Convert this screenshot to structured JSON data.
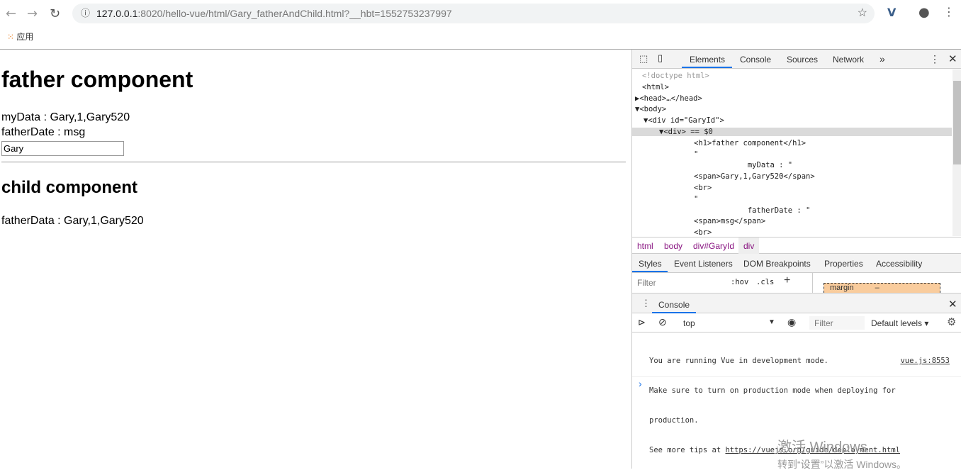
{
  "browser": {
    "url_host": "127.0.0.1",
    "url_rest": ":8020/hello-vue/html/Gary_fatherAndChild.html?__hbt=1552753237997",
    "bookmark": "应用"
  },
  "page": {
    "h1": "father component",
    "mydata_line": "myData : Gary,1,Gary520",
    "fatherdate_line": "fatherDate : msg",
    "input_value": "Gary",
    "h2": "child component",
    "fatherdata_line": "fatherData : Gary,1,Gary520"
  },
  "devtools": {
    "tabs": [
      "Elements",
      "Console",
      "Sources",
      "Network",
      "»"
    ],
    "dom": [
      {
        "t": "<!doctype html>",
        "c": "#999"
      },
      {
        "t": "<html>"
      },
      {
        "t": "▶<head>…</head>"
      },
      {
        "t": "▼<body>"
      },
      {
        "t": "▼<div id=\"GaryId\">"
      },
      {
        "t": "▼<div> == $0"
      },
      {
        "t": "<h1>father component</h1>"
      },
      {
        "t": "\""
      },
      {
        "t": "            myData : \""
      },
      {
        "t": "<span>Gary,1,Gary520</span>"
      },
      {
        "t": "<br>"
      },
      {
        "t": "\""
      },
      {
        "t": "            fatherDate : \""
      },
      {
        "t": "<span>msg</span>"
      },
      {
        "t": "<br>"
      }
    ],
    "breadcrumbs": [
      "html",
      "body",
      "div#GaryId",
      "div"
    ],
    "style_tabs": [
      "Styles",
      "Event Listeners",
      "DOM Breakpoints",
      "Properties",
      "Accessibility"
    ],
    "filter_placeholder": "Filter",
    "hov": ":hov",
    "cls": ".cls",
    "plus": "+",
    "margin": "margin",
    "margin_val": "–",
    "drawer_tab": "Console",
    "context": "top",
    "console_filter": "Filter",
    "levels": "Default levels ▾",
    "messages": {
      "line1": "You are running Vue in development mode.",
      "source": "vue.js:8553",
      "line2": "Make sure to turn on production mode when deploying for",
      "line3": "production.",
      "line4_prefix": "See more tips at ",
      "link": "https://vuejs.org/guide/deployment.html"
    },
    "prompt": "›"
  },
  "watermark": {
    "line1": "激活 Windows",
    "line2": "转到“设置”以激活 Windows。"
  },
  "colors": {
    "accent": "#1a73e8",
    "selected_row": "#dadada",
    "margin_box": "#f9cc9d"
  }
}
